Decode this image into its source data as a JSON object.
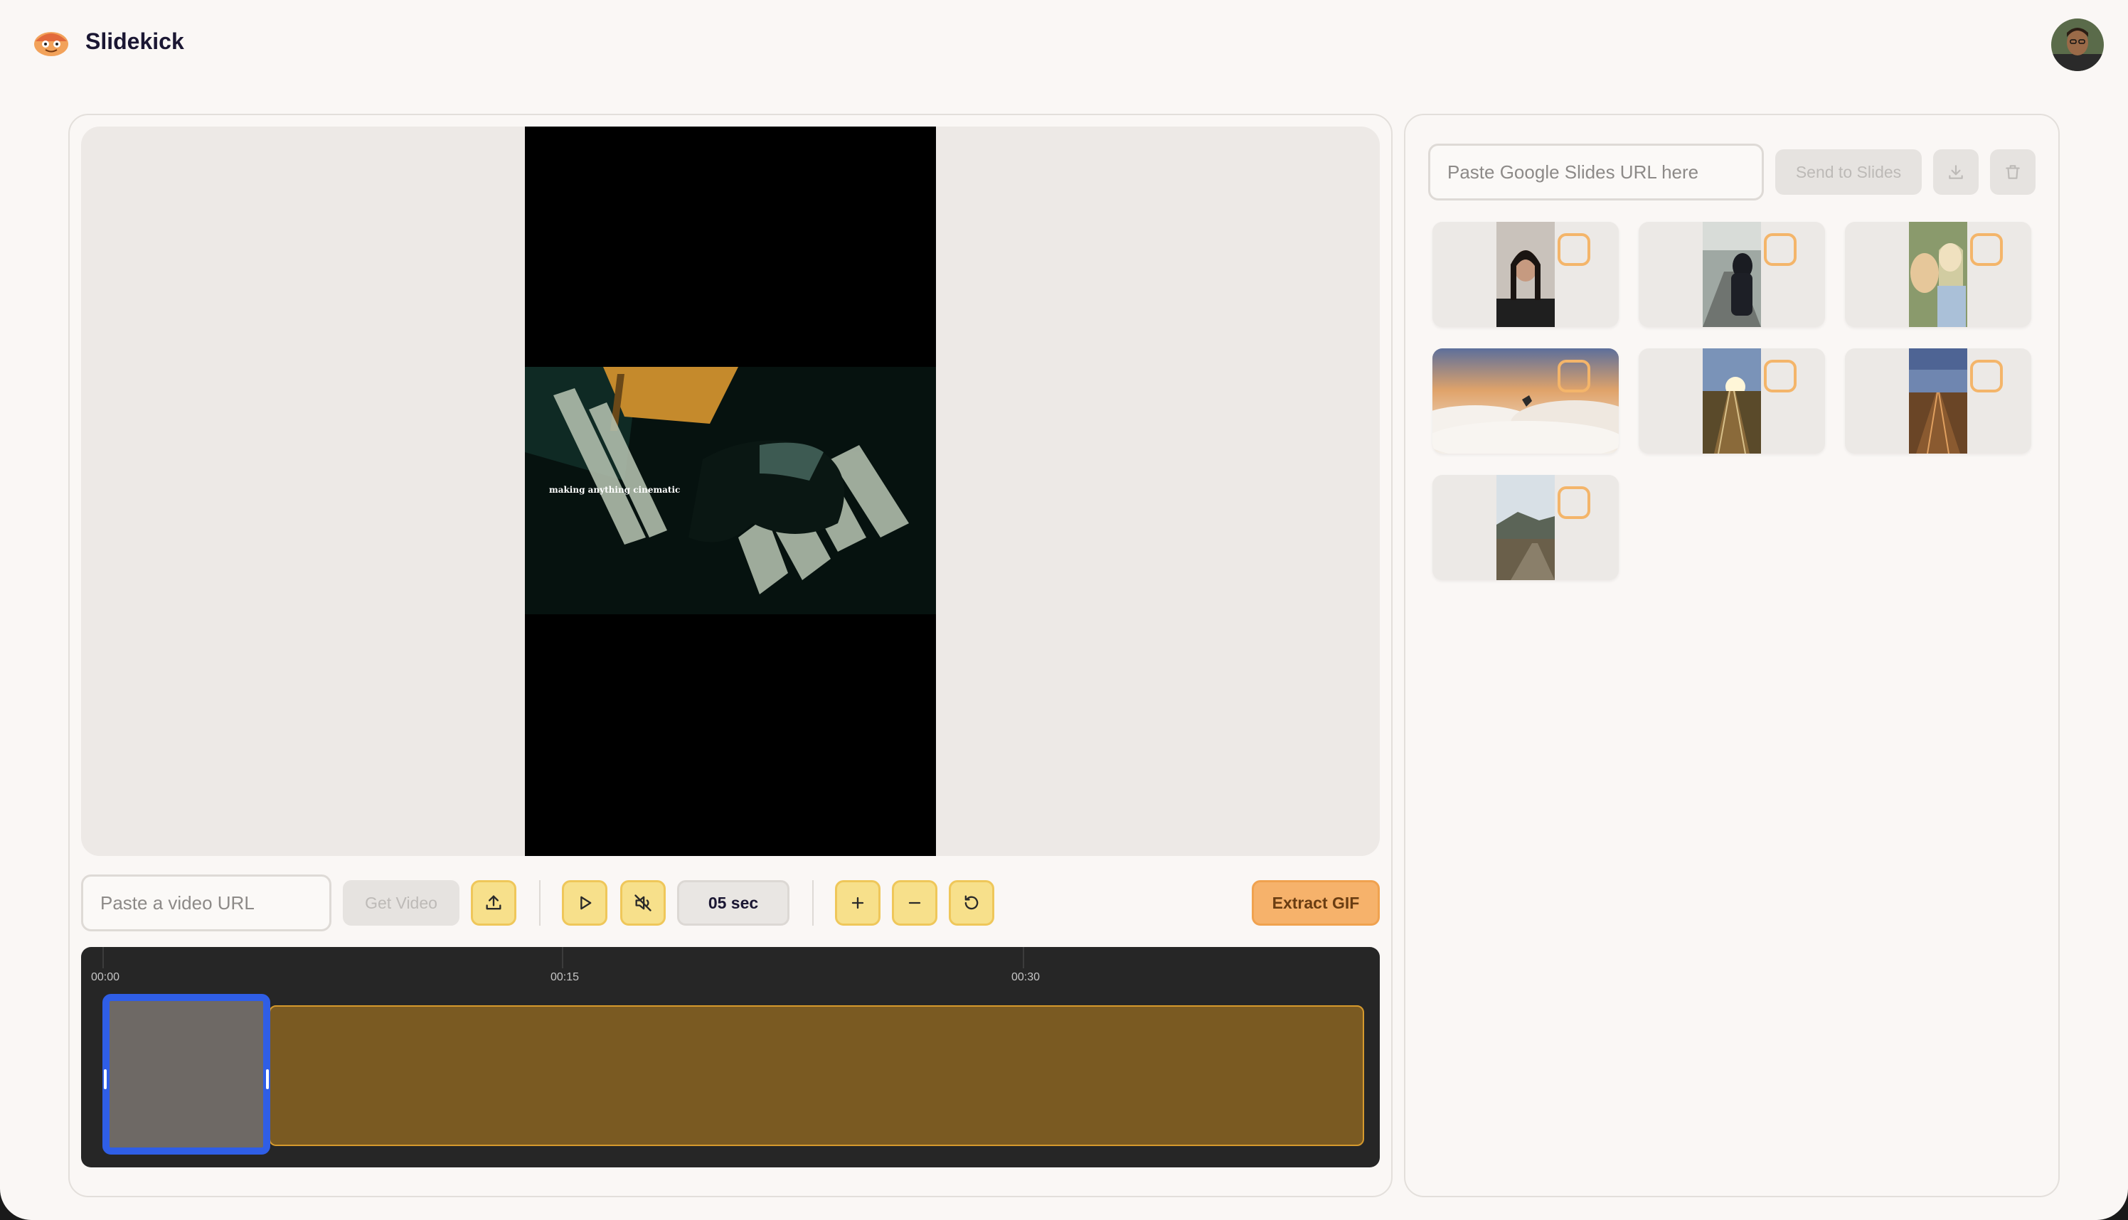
{
  "app": {
    "name": "Slidekick"
  },
  "icons": {
    "logo": "slidekick-logo-icon",
    "avatar": "user-avatar",
    "upload": "upload-icon",
    "play": "play-icon",
    "mute": "mute-icon",
    "zoom_in": "plus-icon",
    "zoom_out": "minus-icon",
    "reset": "reset-icon",
    "download": "download-icon",
    "trash": "trash-icon"
  },
  "video": {
    "caption": "making anything cinematic",
    "url_placeholder": "Paste a video URL",
    "get_label": "Get Video",
    "duration_label": "05 sec",
    "extract_label": "Extract GIF"
  },
  "timeline": {
    "ticks": [
      "00:00",
      "00:15",
      "00:30"
    ]
  },
  "slides": {
    "url_placeholder": "Paste Google Slides URL here",
    "send_label": "Send to Slides",
    "thumbnails": [
      {
        "subject": "woman-portrait",
        "checked": false
      },
      {
        "subject": "person-in-hood",
        "checked": false
      },
      {
        "subject": "woman-with-dog",
        "checked": false
      },
      {
        "subject": "clouds-sunset",
        "checked": false
      },
      {
        "subject": "railroad-sunset",
        "checked": false
      },
      {
        "subject": "railroad-tracks",
        "checked": false
      },
      {
        "subject": "mountain-road",
        "checked": false
      }
    ]
  },
  "colors": {
    "accent": "#f6b26b",
    "button_yellow": "#f7e08b",
    "selection_blue": "#2f5ee6",
    "track": "#7a5a22"
  }
}
